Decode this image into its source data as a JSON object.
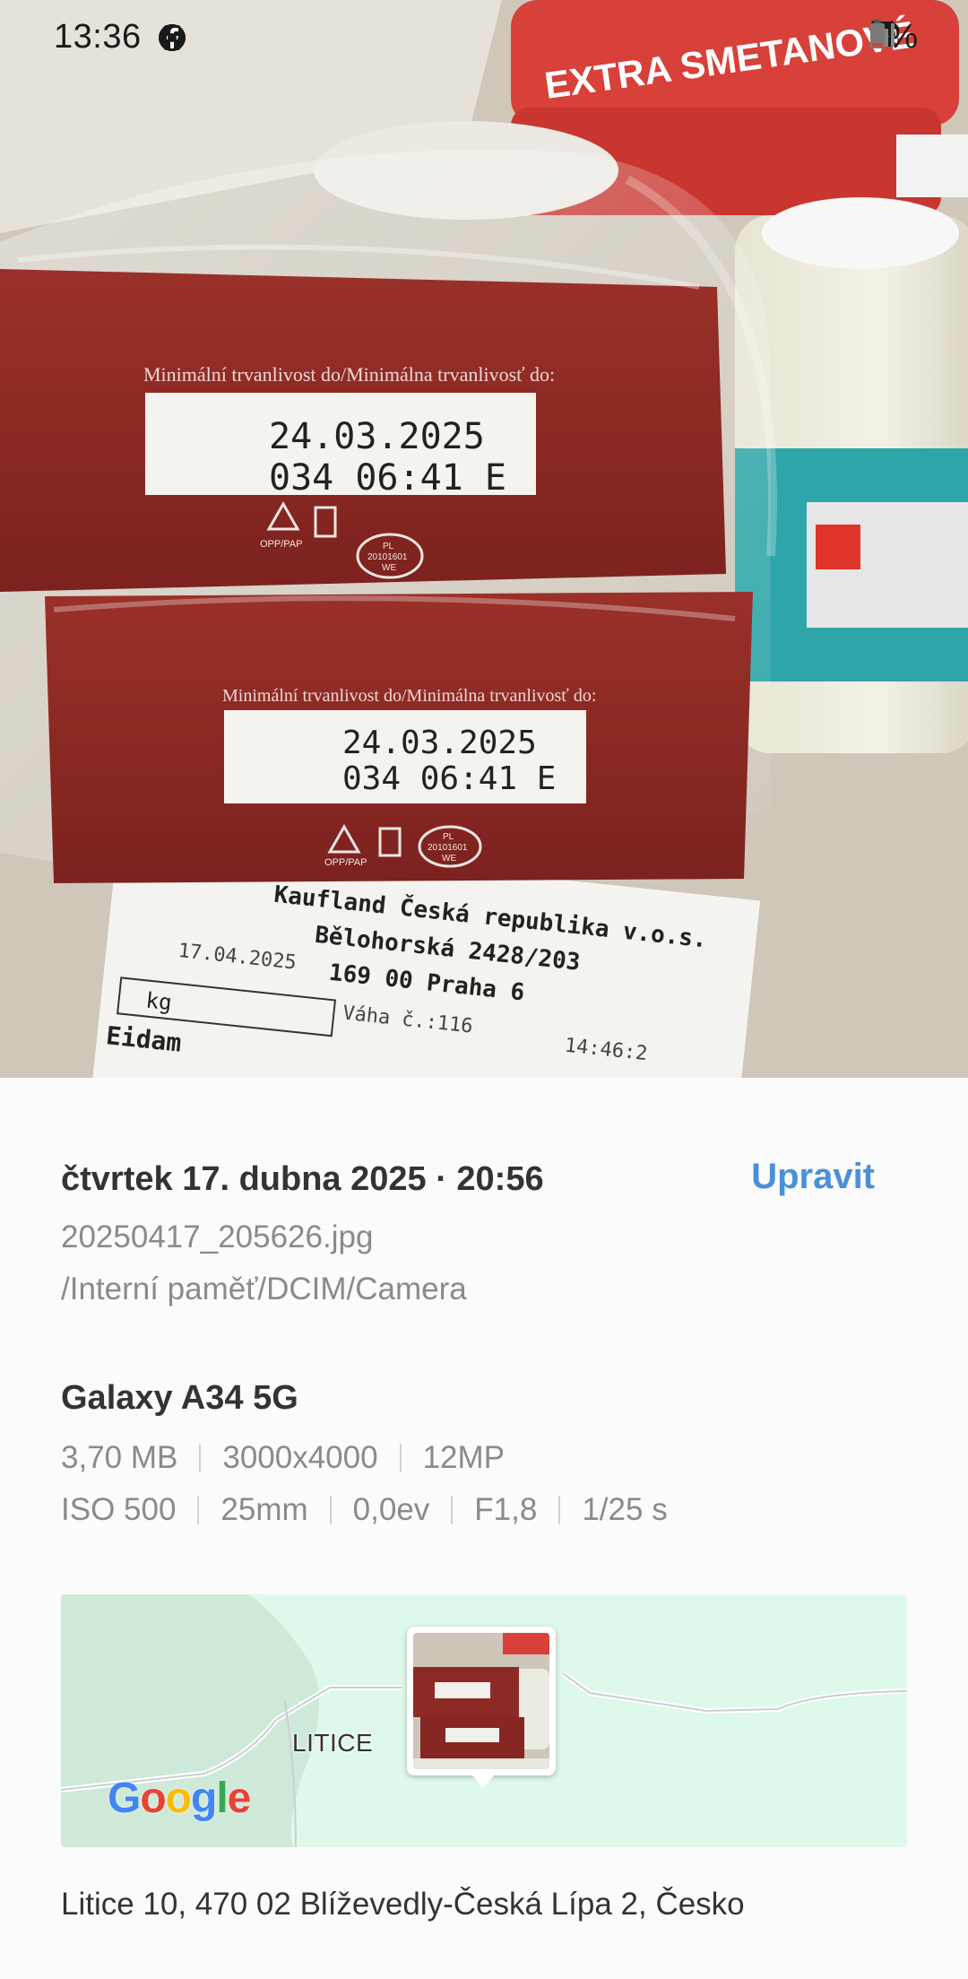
{
  "status_bar": {
    "time": "13:36",
    "battery_percent": "5%",
    "left_icons": [
      "alert-icon",
      "facebook-icon",
      "facebook-icon",
      "dot-icon"
    ],
    "right_icons": [
      "nfc-icon",
      "alarm-icon",
      "mute-icon",
      "wifi-icon",
      "signal-icon",
      "battery-icon"
    ]
  },
  "photo": {
    "label_text": "Minimální trvanlivost do/Minimálna trvanlivosť do:",
    "best_before_date": "24.03.2025",
    "code_line": "034   06:41 E",
    "recycling_code": "OPP/PAP",
    "stamp_text_1": "PL",
    "stamp_text_2": "20101601",
    "stamp_text_3": "WE",
    "tub_text": "EXTRA SMETANOVÉ",
    "receipt_line_1": "Kaufland Česká republika v.o.s.",
    "receipt_line_2": "Bělohorská 2428/203",
    "receipt_line_3": "169 00 Praha 6",
    "receipt_date": "17.04.2025",
    "receipt_scale": "Váha č.:116",
    "receipt_time": "14:46:2",
    "receipt_unit": "kg",
    "receipt_item": "Eidam"
  },
  "details": {
    "date_time": "čtvrtek 17. dubna 2025 · 20:56",
    "edit_label": "Upravit",
    "filename": "20250417_205626.jpg",
    "path": "/Interní paměť/DCIM/Camera",
    "device": "Galaxy A34 5G",
    "file_meta": [
      "3,70 MB",
      "3000x4000",
      "12MP"
    ],
    "camera_meta": [
      "ISO 500",
      "25mm",
      "0,0ev",
      "F1,8",
      "1/25 s"
    ],
    "map": {
      "place_label": "LITICE",
      "logo": "Google",
      "logo_parts": [
        "G",
        "o",
        "o",
        "g",
        "l",
        "e"
      ]
    },
    "address": "Litice 10, 470 02 Blíževedly-Česká Lípa 2, Česko"
  },
  "colors": {
    "accent": "#4a90d9",
    "package_red": "#8e2a26",
    "map_green": "#dcf6e7"
  }
}
